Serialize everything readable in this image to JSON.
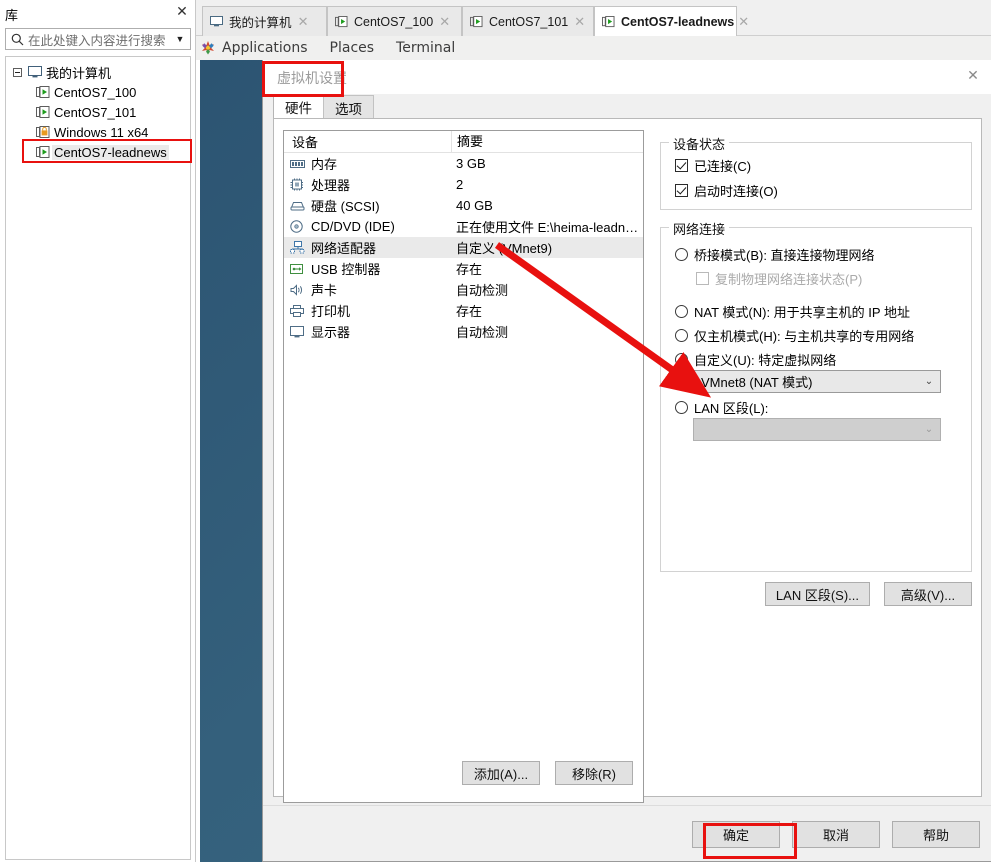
{
  "library": {
    "title": "库",
    "close_label": "✕",
    "search": {
      "placeholder": "在此处键入内容进行搜索",
      "value": "",
      "icon": "search-icon",
      "dropdown_icon": "chevron-down-icon"
    },
    "tree": {
      "root": {
        "label": "我的计算机",
        "icon": "computer-icon",
        "expander": "minus-box"
      },
      "items": [
        {
          "label": "CentOS7_100",
          "icon": "vm-powered-on-icon",
          "selected": false
        },
        {
          "label": "CentOS7_101",
          "icon": "vm-powered-on-icon",
          "selected": false
        },
        {
          "label": "Windows 11 x64",
          "icon": "vm-suspended-icon",
          "selected": false
        },
        {
          "label": "CentOS7-leadnews",
          "icon": "vm-powered-on-icon",
          "selected": true
        }
      ]
    }
  },
  "tabbar": {
    "tabs": [
      {
        "label": "我的计算机",
        "icon": "computer-icon",
        "active": false,
        "close": "✕"
      },
      {
        "label": "CentOS7_100",
        "icon": "vm-powered-on-icon",
        "active": false,
        "close": "✕"
      },
      {
        "label": "CentOS7_101",
        "icon": "vm-powered-on-icon",
        "active": false,
        "close": "✕"
      },
      {
        "label": "CentOS7-leadnews",
        "icon": "vm-powered-on-icon",
        "active": true,
        "close": "✕"
      }
    ]
  },
  "guest_topbar": {
    "applications": "Applications",
    "places": "Places",
    "terminal": "Terminal",
    "menu_icon": "gnome-applications-icon"
  },
  "dialog": {
    "title": "虚拟机设置",
    "close_label": "✕",
    "tabs": [
      {
        "label": "硬件",
        "active": true
      },
      {
        "label": "选项",
        "active": false
      }
    ],
    "device_table": {
      "headers": [
        "设备",
        "摘要"
      ],
      "rows": [
        {
          "device": "内存",
          "summary": "3 GB",
          "icon": "memory-icon",
          "selected": false
        },
        {
          "device": "处理器",
          "summary": "2",
          "icon": "cpu-icon",
          "selected": false
        },
        {
          "device": "硬盘 (SCSI)",
          "summary": "40 GB",
          "icon": "harddisk-icon",
          "selected": false
        },
        {
          "device": "CD/DVD (IDE)",
          "summary": "正在使用文件 E:\\heima-leadne...",
          "icon": "cd-dvd-icon",
          "selected": false
        },
        {
          "device": "网络适配器",
          "summary": "自定义 (VMnet9)",
          "icon": "network-adapter-icon",
          "selected": true
        },
        {
          "device": "USB 控制器",
          "summary": "存在",
          "icon": "usb-icon",
          "selected": false
        },
        {
          "device": "声卡",
          "summary": "自动检测",
          "icon": "sound-card-icon",
          "selected": false
        },
        {
          "device": "打印机",
          "summary": "存在",
          "icon": "printer-icon",
          "selected": false
        },
        {
          "device": "显示器",
          "summary": "自动检测",
          "icon": "display-icon",
          "selected": false
        }
      ]
    },
    "device_buttons": {
      "add": "添加(A)...",
      "remove": "移除(R)"
    },
    "device_status": {
      "legend": "设备状态",
      "connected": {
        "label": "已连接(C)",
        "checked": true
      },
      "connect_at_power_on": {
        "label": "启动时连接(O)",
        "checked": true
      }
    },
    "network_connection": {
      "legend": "网络连接",
      "options": [
        {
          "label": "桥接模式(B): 直接连接物理网络",
          "selected": false
        },
        {
          "label": "NAT 模式(N): 用于共享主机的 IP 地址",
          "selected": false
        },
        {
          "label": "仅主机模式(H): 与主机共享的专用网络",
          "selected": false
        },
        {
          "label": "自定义(U): 特定虚拟网络",
          "selected": true
        },
        {
          "label": "LAN 区段(L):",
          "selected": false
        }
      ],
      "replicate_state": {
        "label": "复制物理网络连接状态(P)",
        "checked": false,
        "disabled": true
      },
      "custom_network": {
        "value": "VMnet8 (NAT 模式)",
        "arrow_icon": "chevron-down-icon"
      },
      "lan_segment": {
        "value": "",
        "disabled": true,
        "arrow_icon": "chevron-down-icon"
      },
      "buttons": {
        "lan_segments": "LAN 区段(S)...",
        "advanced": "高级(V)..."
      }
    },
    "footer_buttons": {
      "ok": "确定",
      "cancel": "取消",
      "help": "帮助"
    }
  },
  "annotations": {
    "accent_color": "#e8110f",
    "highlight_title": "虚拟机设置",
    "highlight_ok": "确定",
    "highlight_library_item": "CentOS7-leadnews",
    "arrow": {
      "from": "网络适配器 摘要 自定义 (VMnet9)",
      "to": "VMnet8 (NAT 模式)"
    }
  }
}
